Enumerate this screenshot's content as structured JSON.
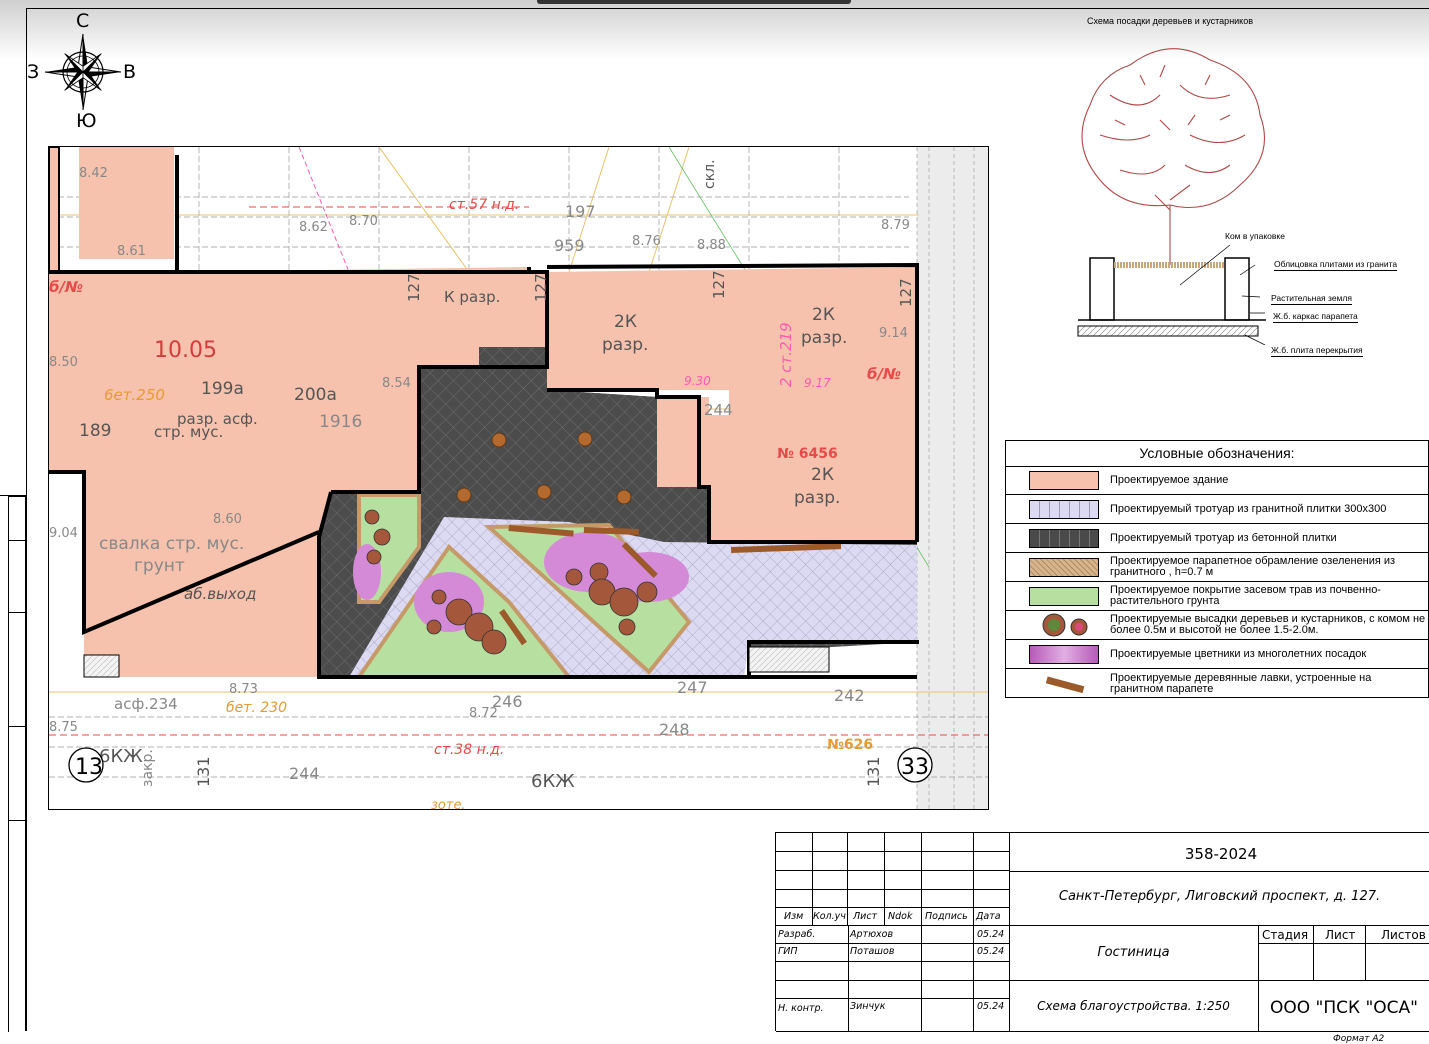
{
  "compass": {
    "north": "С",
    "south": "Ю",
    "west": "З",
    "east": "В"
  },
  "tree_scheme": {
    "title": "Схема посадки деревьев и кустарников",
    "callouts": [
      "Ком в упаковке",
      "Облицовка плитами из гранита",
      "Растительная земля",
      "Ж.б. каркас парапета",
      "Ж.б. плита перекрытия"
    ]
  },
  "legend": {
    "title": "Условные обозначения:",
    "items": [
      {
        "label": "Проектируемое здание",
        "color": "#f6c2ad"
      },
      {
        "label": "Проектируемый тротуар из гранитной плитки 300х300",
        "color": "#d9d6f2"
      },
      {
        "label": "Проектируемый тротуар из бетонной плитки",
        "color": "#4a4a4a"
      },
      {
        "label": "Проектируемое парапетное обрамление озеленения из гранитного , h=0.7 м",
        "color": "#d8b48c"
      },
      {
        "label": "Проектируемое покрытие засевом трав из почвенно-растительного грунта",
        "color": "#b7e0a0"
      },
      {
        "label": "Проектируемые высадки деревьев и кустарников, с комом не более 0.5м и высотой не более 1.5-2.0м.",
        "color": "#a4573b"
      },
      {
        "label": "Проектируемые цветники из многолетних посадок",
        "color": "#d58ad8"
      },
      {
        "label": "Проектируемые деревянные лавки, устроенные на гранитном парапете",
        "color": "#9c5a2a"
      }
    ]
  },
  "plan": {
    "labels": {
      "area": "10.05",
      "k_razr_1": "К разр.",
      "k2_a": "2К",
      "razr_a": "разр.",
      "k2_b": "2К",
      "razr_b": "разр.",
      "k2_c": "2К",
      "razr_c": "разр.",
      "bet250": "6ет.250",
      "n199a": "199а",
      "n200a": "200а",
      "n189": "189",
      "razr_asf": "разр. асф.",
      "str_mus": "стр. мус.",
      "svalka": "свалка стр. мус.",
      "grunt": "грунт",
      "ab_vyhod": "аб.выход",
      "n6456": "№ 6456",
      "b_n": "б/№",
      "skl": "скл.",
      "st57": "ст.57 н.д.",
      "st38": "ст.38 н.д.",
      "asf234": "асф.234",
      "bet230": "бет. 230",
      "n6kzh_a": "6КЖ",
      "n6kzh_b": "6КЖ",
      "n13": "13",
      "n33": "33",
      "n131a": "131",
      "n131b": "131",
      "n244": "244",
      "n246": "246",
      "n247": "247",
      "n248": "248",
      "n242": "242",
      "n626": "№626",
      "v850": "8.50",
      "v860": "8.60",
      "v854": "8.54",
      "v873": "8.73",
      "v875": "8.75",
      "v872": "8.72",
      "v842": "8.42",
      "v861": "8.61",
      "v862": "8.62",
      "v870": "8.70",
      "v876": "8.76",
      "v888": "8.88",
      "v879": "8.79",
      "v914": "9.14",
      "v917": "9.17",
      "v930": "9.30",
      "v127a": "127",
      "v127b": "127",
      "v127c": "127",
      "v127d": "127",
      "st219": "2 ст.219",
      "n244b": "244",
      "v904": "9.04",
      "v959": "959",
      "v197": "197",
      "v1916": "1916",
      "zakr": "закр.",
      "zote": "зоте."
    }
  },
  "title_block": {
    "code": "358-2024",
    "address": "Санкт-Петербург, Лиговский проспект, д. 127.",
    "object": "Гостиница",
    "sheet_title": "Схема благоустройства. 1:250",
    "company": "ООО \"ПСК \"ОСА\"",
    "col_headers": [
      "Изм",
      "Кол.уч",
      "Лист",
      "Ndok",
      "Подпись",
      "Дата"
    ],
    "rows": [
      {
        "role": "Разраб.",
        "name": "Артюхов",
        "date": "05.24"
      },
      {
        "role": "ГИП",
        "name": "Поташов",
        "date": "05.24"
      },
      {
        "role": "Н. контр.",
        "name": "Зинчук",
        "date": "05.24"
      }
    ],
    "stage_headers": [
      "Стадия",
      "Лист",
      "Листов"
    ],
    "format": "Формат А2"
  }
}
